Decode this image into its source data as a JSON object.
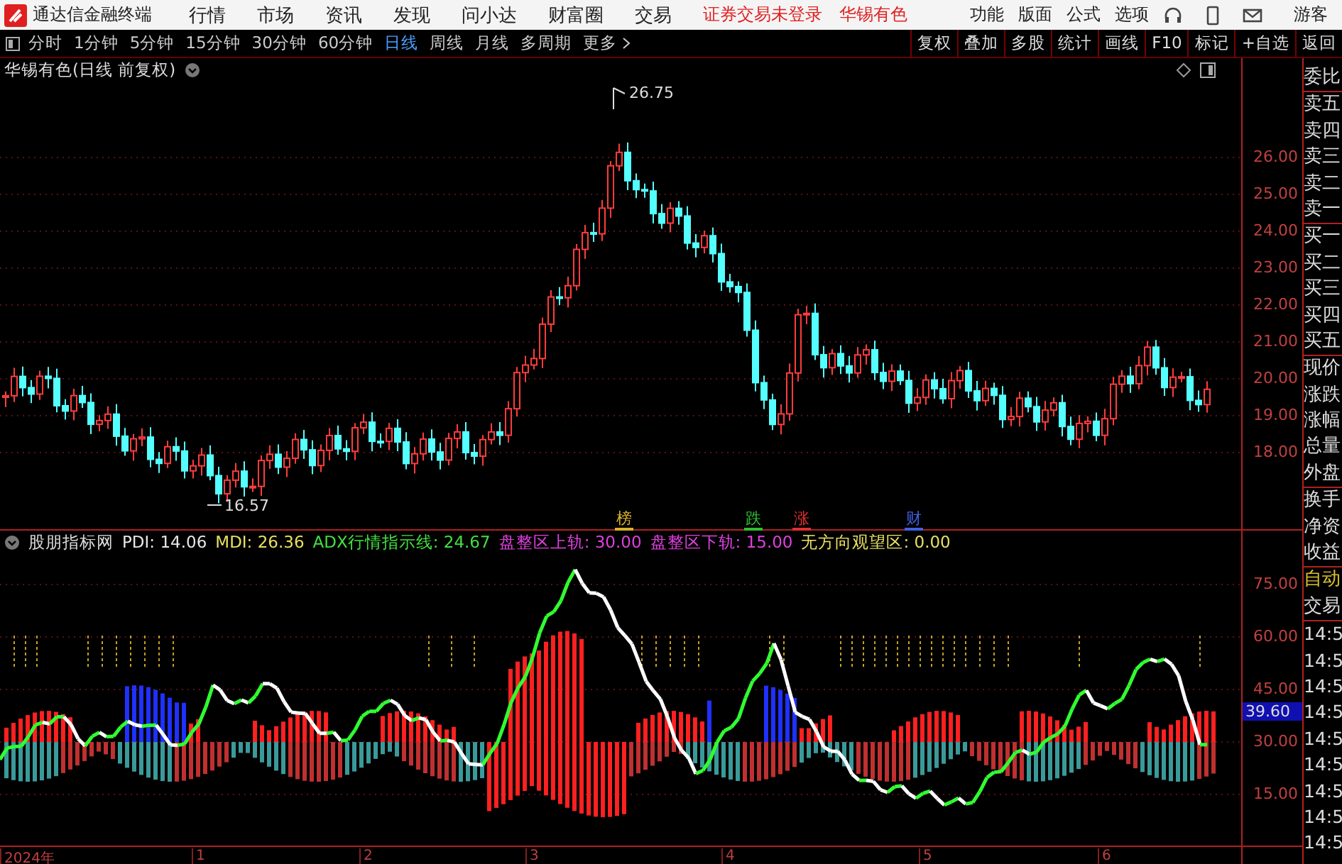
{
  "top_bar": {
    "app_title": "通达信金融终端",
    "menus": [
      "行情",
      "市场",
      "资讯",
      "发现",
      "问小达",
      "财富圈",
      "交易"
    ],
    "login_status": "证券交易未登录",
    "stock_name": "华锡有色",
    "right_menus": [
      "功能",
      "版面",
      "公式",
      "选项"
    ],
    "user": "游客"
  },
  "toolbar": {
    "periods": [
      {
        "label": "分时",
        "selected": false
      },
      {
        "label": "1分钟",
        "selected": false
      },
      {
        "label": "5分钟",
        "selected": false
      },
      {
        "label": "15分钟",
        "selected": false
      },
      {
        "label": "30分钟",
        "selected": false
      },
      {
        "label": "60分钟",
        "selected": false
      },
      {
        "label": "日线",
        "selected": true
      },
      {
        "label": "周线",
        "selected": false
      },
      {
        "label": "月线",
        "selected": false
      },
      {
        "label": "多周期",
        "selected": false
      }
    ],
    "more": "更多",
    "buttons": [
      "复权",
      "叠加",
      "多股",
      "统计",
      "画线",
      "F10",
      "标记",
      "+自选",
      "返回"
    ]
  },
  "price_chart": {
    "title": "华锡有色(日线 前复权)",
    "high_label": "26.75",
    "low_label": "16.57",
    "events": [
      {
        "label": "榜",
        "color": "#d8b030"
      },
      {
        "label": "跌",
        "color": "#30c030"
      },
      {
        "label": "涨",
        "color": "#e03030"
      },
      {
        "label": "财",
        "color": "#4060e0"
      }
    ],
    "axis_labels": [
      "26.00",
      "25.00",
      "24.00",
      "23.00",
      "22.00",
      "21.00",
      "20.00",
      "19.00",
      "18.00"
    ]
  },
  "indicator": {
    "name": "股朋指标网",
    "values": [
      {
        "label": "PDI: 14.06",
        "color": "#e8e8e8"
      },
      {
        "label": "MDI: 26.36",
        "color": "#e8e060"
      },
      {
        "label": "ADX行情指示线: 24.67",
        "color": "#40e040"
      },
      {
        "label": "盘整区上轨: 30.00",
        "color": "#e040e0"
      },
      {
        "label": "盘整区下轨: 15.00",
        "color": "#e040e0"
      },
      {
        "label": "无方向观望区: 0.00",
        "color": "#e8e060"
      }
    ],
    "axis_labels": [
      "75.00",
      "60.00",
      "45.00",
      "30.00",
      "15.00"
    ],
    "current_value": "39.60"
  },
  "x_axis": [
    "2024年",
    "1",
    "2",
    "3",
    "4",
    "5",
    "6"
  ],
  "side_panel": {
    "groups": [
      [
        "委比"
      ],
      [
        "卖五",
        "卖四",
        "卖三",
        "卖二",
        "卖一"
      ],
      [
        "买一",
        "买二",
        "买三",
        "买四",
        "买五"
      ],
      [
        "现价",
        "涨跌",
        "涨幅",
        "总量",
        "外盘"
      ],
      [
        "换手",
        "净资",
        "收益"
      ]
    ],
    "auto_label": "自动",
    "trade_label": "交易",
    "times": [
      "14:5",
      "14:5",
      "14:5",
      "14:5",
      "14:5",
      "14:5",
      "14:5",
      "14:5",
      "14:5"
    ]
  }
}
